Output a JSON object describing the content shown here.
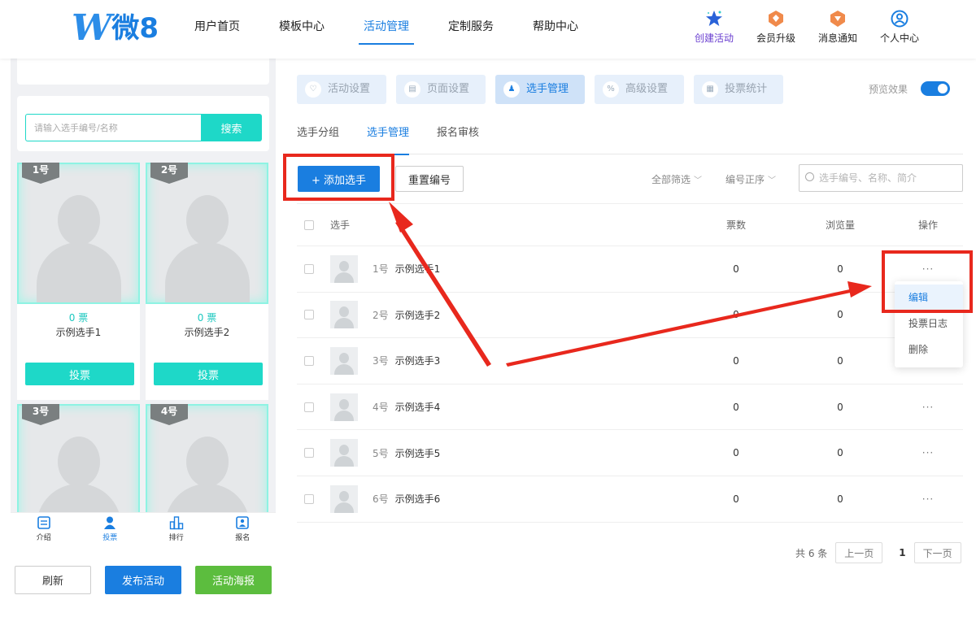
{
  "header": {
    "logo_text": "微8",
    "logo_w": "W",
    "nav": [
      "用户首页",
      "模板中心",
      "活动管理",
      "定制服务",
      "帮助中心"
    ],
    "nav_active_index": 2,
    "actions": [
      {
        "label": "创建活动",
        "icon": "star-icon"
      },
      {
        "label": "会员升级",
        "icon": "badge-icon"
      },
      {
        "label": "消息通知",
        "icon": "bell-badge-icon"
      },
      {
        "label": "个人中心",
        "icon": "user-circle-icon"
      }
    ]
  },
  "preview": {
    "search_placeholder": "请输入选手编号/名称",
    "search_button": "搜索",
    "cards": [
      {
        "tag": "1号",
        "votes": "0 票",
        "name": "示例选手1",
        "vote_button": "投票"
      },
      {
        "tag": "2号",
        "votes": "0 票",
        "name": "示例选手2",
        "vote_button": "投票"
      },
      {
        "tag": "3号"
      },
      {
        "tag": "4号"
      }
    ],
    "bottom_tabs": [
      {
        "label": "介绍",
        "icon": "intro-icon"
      },
      {
        "label": "投票",
        "icon": "person-icon"
      },
      {
        "label": "排行",
        "icon": "ranking-icon"
      },
      {
        "label": "报名",
        "icon": "signup-icon"
      }
    ],
    "bottom_tab_active": 1,
    "buttons": {
      "refresh": "刷新",
      "publish": "发布活动",
      "poster": "活动海报"
    }
  },
  "panel": {
    "subtabs": [
      {
        "label": "活动设置",
        "icon": "heart-icon"
      },
      {
        "label": "页面设置",
        "icon": "page-icon"
      },
      {
        "label": "选手管理",
        "icon": "contestant-icon"
      },
      {
        "label": "高级设置",
        "icon": "percent-icon"
      },
      {
        "label": "投票统计",
        "icon": "stats-icon"
      }
    ],
    "subtab_active": 2,
    "preview_label": "预览效果",
    "tabs": [
      "选手分组",
      "选手管理",
      "报名审核"
    ],
    "tab_active": 1,
    "add_button": "+ 添加选手",
    "reset_button": "重置编号",
    "filter_all": "全部筛选",
    "filter_order": "编号正序",
    "search_placeholder": "选手编号、名称、简介",
    "columns": {
      "player": "选手",
      "votes": "票数",
      "views": "浏览量",
      "ops": "操作"
    },
    "rows": [
      {
        "num": "1号",
        "name": "示例选手1",
        "votes": "0",
        "views": "0"
      },
      {
        "num": "2号",
        "name": "示例选手2",
        "votes": "0",
        "views": "0"
      },
      {
        "num": "3号",
        "name": "示例选手3",
        "votes": "0",
        "views": "0"
      },
      {
        "num": "4号",
        "name": "示例选手4",
        "votes": "0",
        "views": "0"
      },
      {
        "num": "5号",
        "name": "示例选手5",
        "votes": "0",
        "views": "0"
      },
      {
        "num": "6号",
        "name": "示例选手6",
        "votes": "0",
        "views": "0"
      }
    ],
    "ops_dots": "···",
    "dropdown": [
      "编辑",
      "投票日志",
      "删除"
    ],
    "pager": {
      "total": "共 6 条",
      "prev": "上一页",
      "current": "1",
      "next": "下一页"
    }
  },
  "colors": {
    "primary": "#1a7ee0",
    "teal": "#1ed8c8",
    "green": "#5cbd3e",
    "annotation": "#e8281d"
  }
}
